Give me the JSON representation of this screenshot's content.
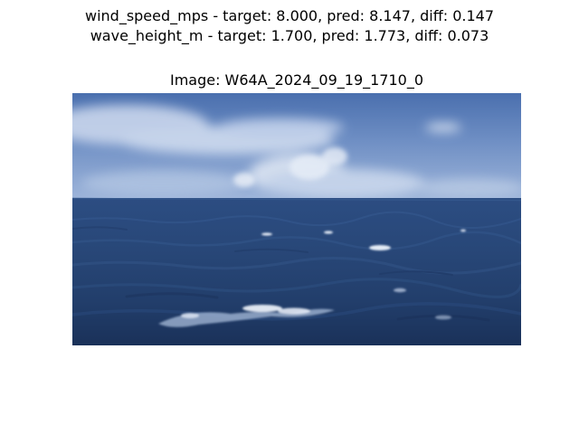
{
  "figure": {
    "suptitle_line1": "wind_speed_mps - target: 8.000, pred: 8.147, diff: 0.147",
    "suptitle_line2": "wave_height_m - target: 1.700, pred: 1.773, diff: 0.073",
    "image_title": "Image: W64A_2024_09_19_1710_0"
  },
  "photo": {
    "subject": "open ocean with dark blue waves, whitecaps in foreground, pale blue sky with thin clouds",
    "colors": {
      "sky_top": "#4a6fae",
      "sky_mid": "#7d9ccd",
      "horizon_haze": "#b8c9e2",
      "sea_far": "#2a4a7e",
      "sea_mid": "#274777",
      "sea_near": "#1d355e",
      "foam": "#e4ecf6"
    }
  }
}
